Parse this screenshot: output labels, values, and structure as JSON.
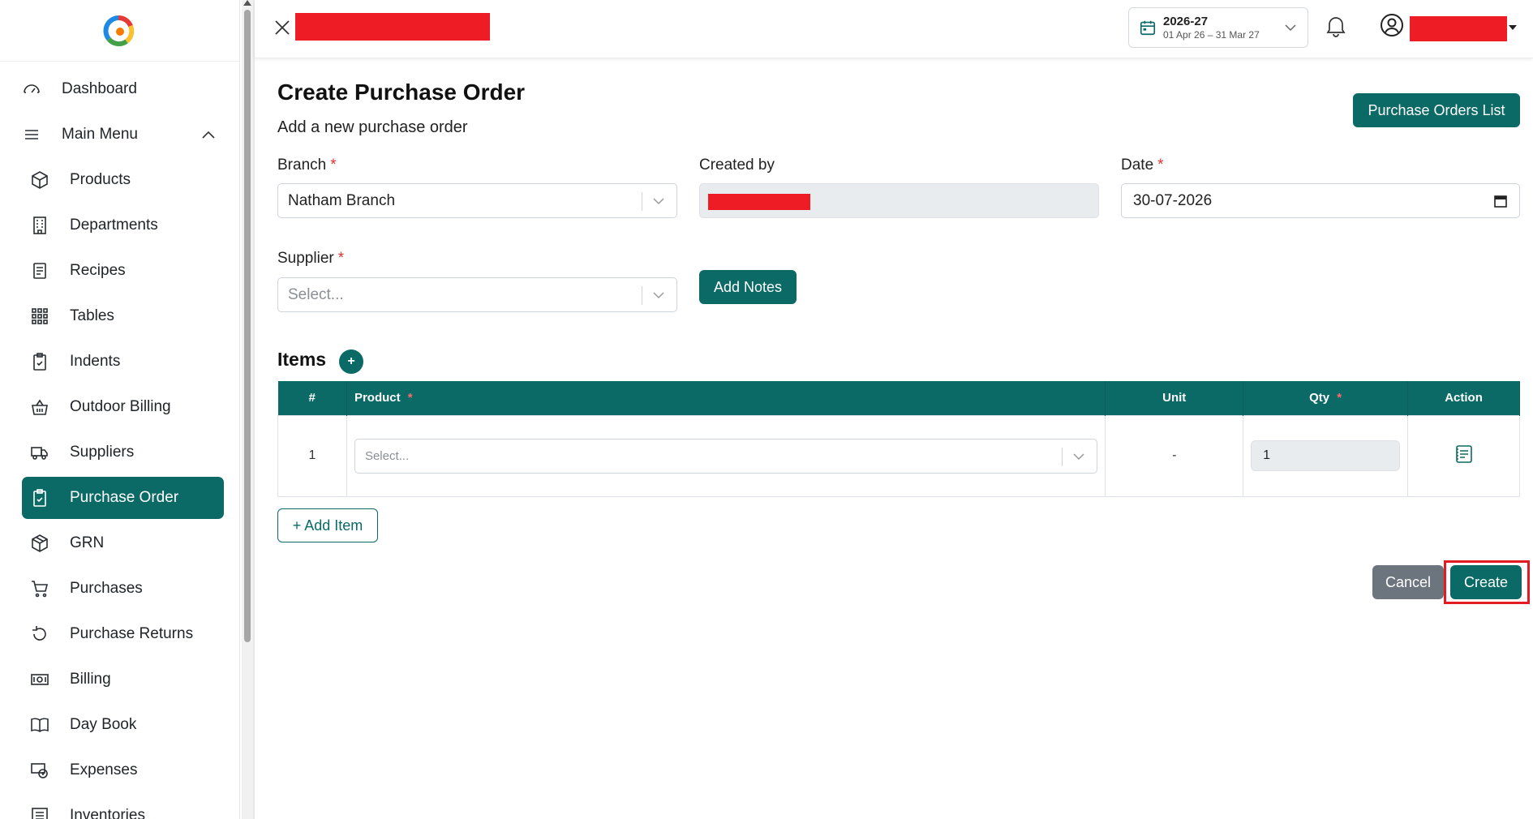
{
  "header": {
    "fiscal_year": "2026-27",
    "fiscal_range": "01 Apr 26 – 31 Mar 27"
  },
  "sidebar": {
    "items": [
      {
        "label": "Dashboard",
        "icon": "gauge-icon"
      },
      {
        "label": "Main Menu",
        "icon": "hamburger-icon"
      },
      {
        "label": "Products",
        "icon": "cube-icon"
      },
      {
        "label": "Departments",
        "icon": "building-icon"
      },
      {
        "label": "Recipes",
        "icon": "receipt-icon"
      },
      {
        "label": "Tables",
        "icon": "grid-icon"
      },
      {
        "label": "Indents",
        "icon": "clipboard-check-icon"
      },
      {
        "label": "Outdoor Billing",
        "icon": "basket-icon"
      },
      {
        "label": "Suppliers",
        "icon": "truck-icon"
      },
      {
        "label": "Purchase Order",
        "icon": "clipboard-check-icon",
        "active": true
      },
      {
        "label": "GRN",
        "icon": "box-icon"
      },
      {
        "label": "Purchases",
        "icon": "cart-icon"
      },
      {
        "label": "Purchase Returns",
        "icon": "return-icon"
      },
      {
        "label": "Billing",
        "icon": "cash-icon"
      },
      {
        "label": "Day Book",
        "icon": "book-icon"
      },
      {
        "label": "Expenses",
        "icon": "expense-icon"
      },
      {
        "label": "Inventories",
        "icon": "list-icon"
      }
    ]
  },
  "page": {
    "title": "Create Purchase Order",
    "subtitle": "Add a new purchase order",
    "list_button": "Purchase Orders List"
  },
  "form": {
    "branch_label": "Branch",
    "branch_value": "Natham Branch",
    "created_by_label": "Created by",
    "date_label": "Date",
    "date_value": "30-07-2026",
    "supplier_label": "Supplier",
    "supplier_placeholder": "Select...",
    "add_notes": "Add Notes",
    "required_mark": "*"
  },
  "items": {
    "title": "Items",
    "add_symbol": "+",
    "columns": [
      "#",
      "Product",
      "Unit",
      "Qty",
      "Action"
    ],
    "rows": [
      {
        "index": "1",
        "product_placeholder": "Select...",
        "unit": "-",
        "qty": "1"
      }
    ],
    "add_item": "+ Add Item"
  },
  "actions": {
    "cancel": "Cancel",
    "create": "Create"
  },
  "colors": {
    "primary": "#0b6a66",
    "redaction": "#ee1c25",
    "highlight": "#e31b23",
    "cancel": "#6c757d"
  }
}
